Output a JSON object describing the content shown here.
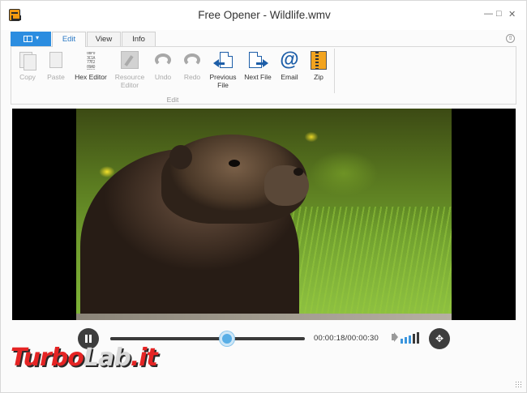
{
  "window": {
    "title": "Free Opener - Wildlife.wmv"
  },
  "tabs": [
    {
      "label": "Edit",
      "active": true
    },
    {
      "label": "View",
      "active": false
    },
    {
      "label": "Info",
      "active": false
    }
  ],
  "ribbon": {
    "group_label": "Edit",
    "buttons": [
      {
        "label": "Copy",
        "icon": "copy-icon",
        "enabled": false
      },
      {
        "label": "Paste",
        "icon": "paste-icon",
        "enabled": false
      },
      {
        "label": "Hex Editor",
        "icon": "hex-editor-icon",
        "enabled": true
      },
      {
        "label": "Resource Editor",
        "icon": "resource-editor-icon",
        "enabled": false
      },
      {
        "label": "Undo",
        "icon": "undo-icon",
        "enabled": false
      },
      {
        "label": "Redo",
        "icon": "redo-icon",
        "enabled": false
      },
      {
        "label": "Previous File",
        "icon": "previous-file-icon",
        "enabled": true
      },
      {
        "label": "Next File",
        "icon": "next-file-icon",
        "enabled": true
      },
      {
        "label": "Email",
        "icon": "email-icon",
        "enabled": true
      },
      {
        "label": "Zip",
        "icon": "zip-icon",
        "enabled": true
      }
    ]
  },
  "player": {
    "time_display": "00:00:18/00:00:30",
    "progress": 0.6,
    "volume_bars_on": 3,
    "volume_bars_total": 5
  },
  "watermark": {
    "part1": "Turbo",
    "part2": "Lab",
    "part3": ".it"
  },
  "colors": {
    "accent": "#2b8de0",
    "seek_knob": "#58aee6",
    "watermark": "#e52424"
  }
}
